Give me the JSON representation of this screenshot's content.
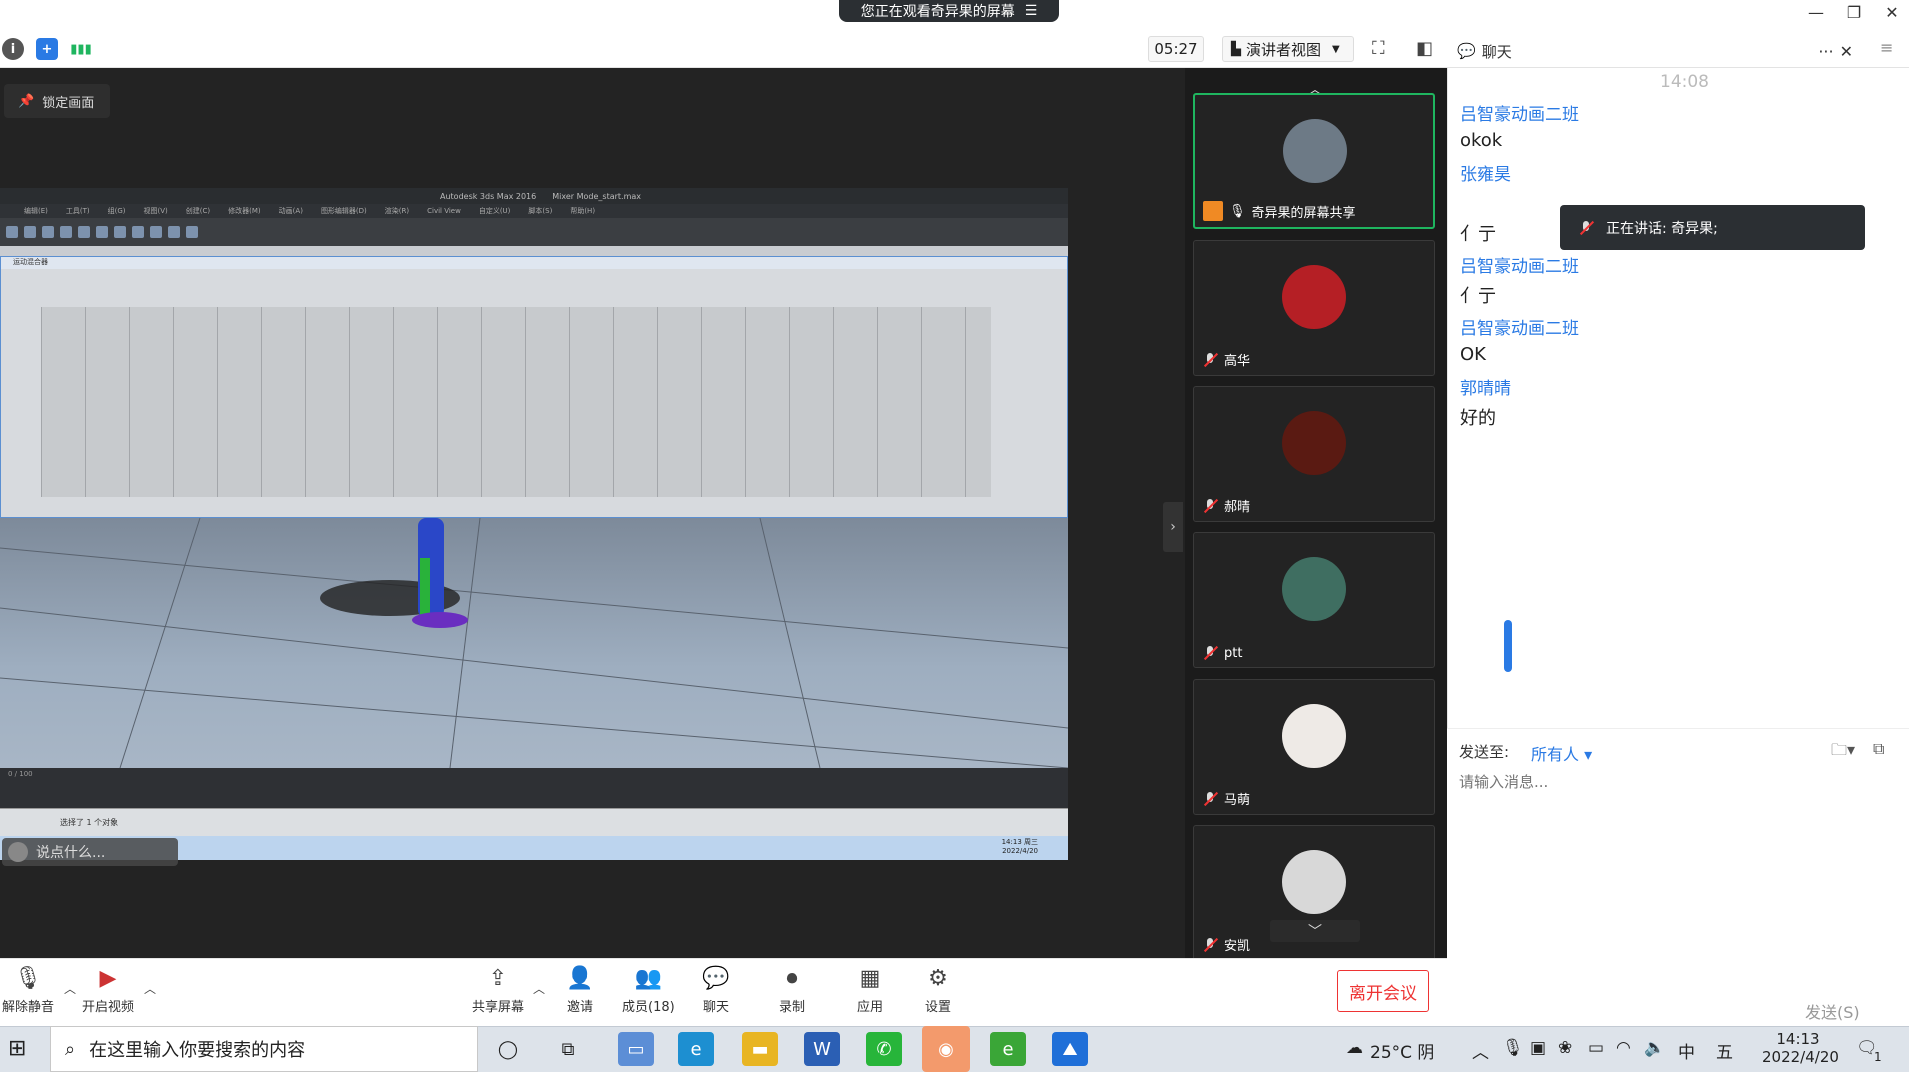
{
  "share_banner": {
    "text": "您正在观看奇异果的屏幕",
    "icon": "menu-icon"
  },
  "toolbar": {
    "timer": "05:27",
    "view_label": "演讲者视图",
    "chat_title": "聊天"
  },
  "lock_label": "锁定画面",
  "max_app": {
    "title": "Autodesk 3ds Max 2016",
    "file": "Mixer Mode_start.max",
    "menus": [
      "编辑(E)",
      "工具(T)",
      "组(G)",
      "视图(V)",
      "创建(C)",
      "修改器(M)",
      "动画(A)",
      "图形编辑器(D)",
      "渲染(R)",
      "Civil View",
      "自定义(U)",
      "脚本(S)",
      "帮助(H)"
    ],
    "mixer_title": "运动混合器",
    "status_text": "选择了 1 个对象",
    "time_display": "0 / 100",
    "bottom_time": "14:13 周三",
    "bottom_date": "2022/4/20"
  },
  "talk_box": "说点什么...",
  "participants": [
    {
      "name": "奇异果的屏幕共享",
      "active": true
    },
    {
      "name": "高华"
    },
    {
      "name": "郝晴"
    },
    {
      "name": "ptt"
    },
    {
      "name": "马萌"
    },
    {
      "name": "安凯"
    }
  ],
  "chat": {
    "time": "14:08",
    "messages": [
      {
        "sender": "吕智豪动画二班",
        "text": "okok"
      },
      {
        "sender": "张雍昊",
        "text": "亻亍"
      },
      {
        "sender": "吕智豪动画二班",
        "text": "亻亍"
      },
      {
        "sender": "吕智豪动画二班",
        "text": "OK"
      },
      {
        "sender": "郭晴晴",
        "text": "好的"
      }
    ],
    "speaking": "正在讲话: 奇异果;",
    "send_to_label": "发送至:",
    "send_to_value": "所有人",
    "input_placeholder": "请输入消息...",
    "send_label": "发送(S)"
  },
  "controls": [
    {
      "label": "解除静音",
      "icon": "mic-off-icon"
    },
    {
      "label": "开启视频",
      "icon": "video-off-icon"
    },
    {
      "label": "共享屏幕",
      "icon": "share-screen-icon"
    },
    {
      "label": "邀请",
      "icon": "invite-icon"
    },
    {
      "label": "成员(18)",
      "icon": "members-icon"
    },
    {
      "label": "聊天",
      "icon": "chat-icon"
    },
    {
      "label": "录制",
      "icon": "record-icon"
    },
    {
      "label": "应用",
      "icon": "apps-icon"
    },
    {
      "label": "设置",
      "icon": "settings-icon"
    }
  ],
  "leave_label": "离开会议",
  "taskbar": {
    "search_placeholder": "在这里输入你要搜索的内容",
    "weather": "25°C 阴",
    "ime": "中",
    "ime2": "五",
    "time": "14:13",
    "date": "2022/4/20",
    "notif": "1"
  },
  "colors": {
    "accent": "#2a7ae4",
    "active": "#1fb55f",
    "leave": "#e33333"
  }
}
